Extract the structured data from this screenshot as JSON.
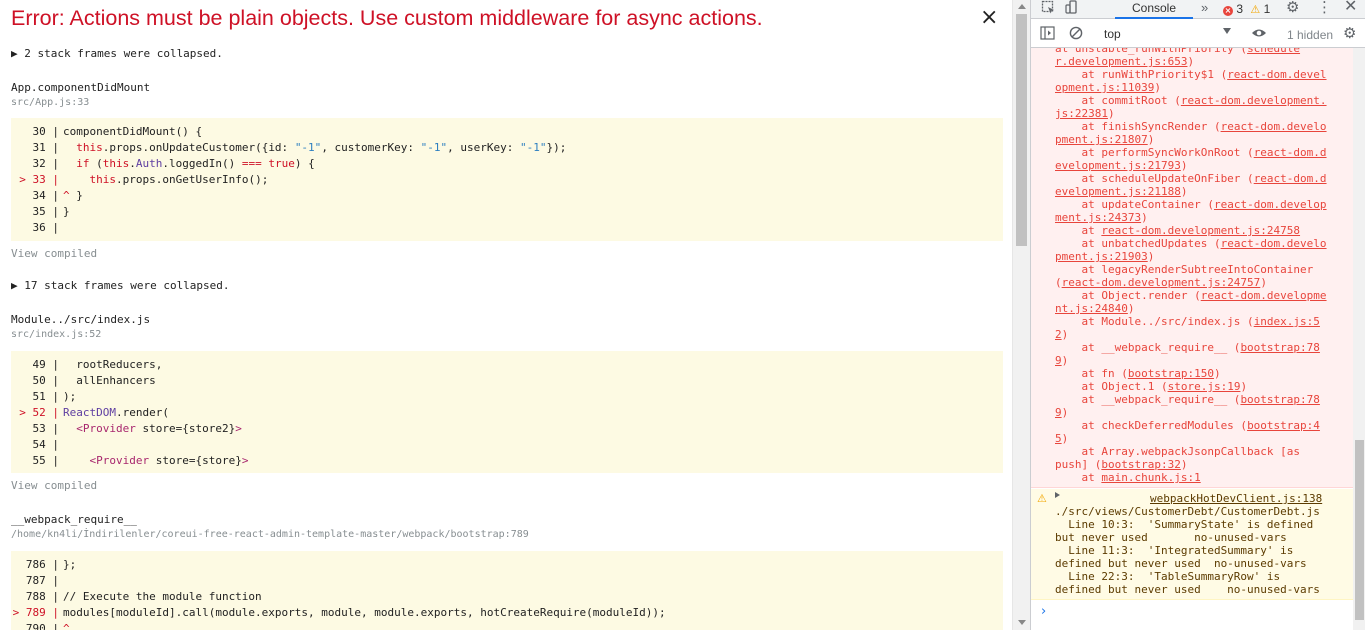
{
  "overlay": {
    "title": "Error: Actions must be plain objects. Use custom middleware for async actions.",
    "close_glyph": "×",
    "collapsed_1": "▶ 2 stack frames were collapsed.",
    "frame_1": {
      "name": "App.componentDidMount",
      "location": "src/App.js:33"
    },
    "view_compiled_1": "View compiled",
    "collapsed_2": "▶ 17 stack frames were collapsed.",
    "frame_2": {
      "name": "Module../src/index.js",
      "location": "src/index.js:52"
    },
    "view_compiled_2": "View compiled",
    "frame_3": {
      "name": "__webpack_require__",
      "location": "/home/kn4li/İndirilenler/coreui-free-react-admin-template-master/webpack/bootstrap:789"
    },
    "code_1": {
      "g30": "30 |",
      "g31": "31 |",
      "g32": "32 |",
      "g33": "> 33 |",
      "g34": "34 |",
      "g35": "35 |",
      "g36": "36 |",
      "l30": "componentDidMount() {",
      "l31_a": "this",
      "l31_b": ".props.onUpdateCustomer({id: ",
      "l31_c": "\"-1\"",
      "l31_d": ", customerKey: ",
      "l31_e": "\"-1\"",
      "l31_f": ", userKey: ",
      "l31_g": "\"-1\"",
      "l31_h": "});",
      "l32_a": "if",
      "l32_b": " (",
      "l32_c": "this",
      "l32_d": ".",
      "l32_e": "Auth",
      "l32_f": ".loggedIn() ",
      "l32_g": "===",
      "l32_h": " ",
      "l32_i": "true",
      "l32_j": ") {",
      "l33_a": "this",
      "l33_b": ".props.onGetUserInfo();",
      "l34_a": "^",
      "l34_b": " }",
      "l35": "}",
      "l36": ""
    },
    "code_2": {
      "g49": "49 |",
      "g50": "50 |",
      "g51": "51 |",
      "g52": "> 52 |",
      "g53": "53 |",
      "g54": "54 |",
      "g55": "55 |",
      "l49": "rootReducers,",
      "l50": "allEnhancers",
      "l51": ");",
      "l52_a": "ReactDOM",
      "l52_b": ".render(",
      "l53_a": "<Provider",
      "l53_b": " store={store2}",
      "l53_c": ">",
      "l54": "",
      "l55_a": "<Provider",
      "l55_b": " store={store}",
      "l55_c": ">"
    },
    "code_3": {
      "g786": "786 |",
      "g787": "787 |",
      "g788": "788 |",
      "g789": "> 789 |",
      "g790": "790 |",
      "l786": "};",
      "l787": "",
      "l788": "// Execute the module function",
      "l789": "modules[moduleId].call(module.exports, module, module.exports, hotCreateRequire(moduleId));",
      "l790": "^"
    }
  },
  "devtools": {
    "tab_console": "Console",
    "more_tabs": "»",
    "error_count": "3",
    "warning_count": "1",
    "context": "top",
    "hidden": "1 hidden",
    "stack": [
      {
        "pre": "at unstable_runWithPriority (",
        "link": "schedule",
        "post": ""
      },
      {
        "pre": "",
        "link": "r.development.js:653",
        "post": ")"
      },
      {
        "pre": "    at runWithPriority$1 (",
        "link": "react-dom.devel",
        "post": ""
      },
      {
        "pre": "",
        "link": "opment.js:11039",
        "post": ")"
      },
      {
        "pre": "    at commitRoot (",
        "link": "react-dom.development.",
        "post": ""
      },
      {
        "pre": "",
        "link": "js:22381",
        "post": ")"
      },
      {
        "pre": "    at finishSyncRender (",
        "link": "react-dom.develo",
        "post": ""
      },
      {
        "pre": "",
        "link": "pment.js:21807",
        "post": ")"
      },
      {
        "pre": "    at performSyncWorkOnRoot (",
        "link": "react-dom.d",
        "post": ""
      },
      {
        "pre": "",
        "link": "evelopment.js:21793",
        "post": ")"
      },
      {
        "pre": "    at scheduleUpdateOnFiber (",
        "link": "react-dom.d",
        "post": ""
      },
      {
        "pre": "",
        "link": "evelopment.js:21188",
        "post": ")"
      },
      {
        "pre": "    at updateContainer (",
        "link": "react-dom.develop",
        "post": ""
      },
      {
        "pre": "",
        "link": "ment.js:24373",
        "post": ")"
      },
      {
        "pre": "    at ",
        "link": "react-dom.development.js:24758",
        "post": ""
      },
      {
        "pre": "    at unbatchedUpdates (",
        "link": "react-dom.develo",
        "post": ""
      },
      {
        "pre": "",
        "link": "pment.js:21903",
        "post": ")"
      },
      {
        "pre": "    at legacyRenderSubtreeIntoContainer",
        "link": "",
        "post": ""
      },
      {
        "pre": "(",
        "link": "react-dom.development.js:24757",
        "post": ")"
      },
      {
        "pre": "    at Object.render (",
        "link": "react-dom.developme",
        "post": ""
      },
      {
        "pre": "",
        "link": "nt.js:24840",
        "post": ")"
      },
      {
        "pre": "    at Module../src/index.js (",
        "link": "index.js:5",
        "post": ""
      },
      {
        "pre": "",
        "link": "2",
        "post": ")"
      },
      {
        "pre": "    at __webpack_require__ (",
        "link": "bootstrap:78",
        "post": ""
      },
      {
        "pre": "",
        "link": "9",
        "post": ")"
      },
      {
        "pre": "    at fn (",
        "link": "bootstrap:150",
        "post": ")"
      },
      {
        "pre": "    at Object.1 (",
        "link": "store.js:19",
        "post": ")"
      },
      {
        "pre": "    at __webpack_require__ (",
        "link": "bootstrap:78",
        "post": ""
      },
      {
        "pre": "",
        "link": "9",
        "post": ")"
      },
      {
        "pre": "    at checkDeferredModules (",
        "link": "bootstrap:4",
        "post": ""
      },
      {
        "pre": "",
        "link": "5",
        "post": ")"
      },
      {
        "pre": "    at Array.webpackJsonpCallback [as",
        "link": "",
        "post": ""
      },
      {
        "pre": "push] (",
        "link": "bootstrap:32",
        "post": ")"
      },
      {
        "pre": "    at ",
        "link": "main.chunk.js:1",
        "post": ""
      }
    ],
    "warning": {
      "link": "webpackHotDevClient.js:138",
      "text": "./src/views/CustomerDebt/CustomerDebt.js\n  Line 10:3:  'SummaryState' is defined\nbut never used       no-unused-vars\n  Line 11:3:  'IntegratedSummary' is\ndefined but never used  no-unused-vars\n  Line 22:3:  'TableSummaryRow' is\ndefined but never used    no-unused-vars"
    },
    "prompt": "›"
  }
}
